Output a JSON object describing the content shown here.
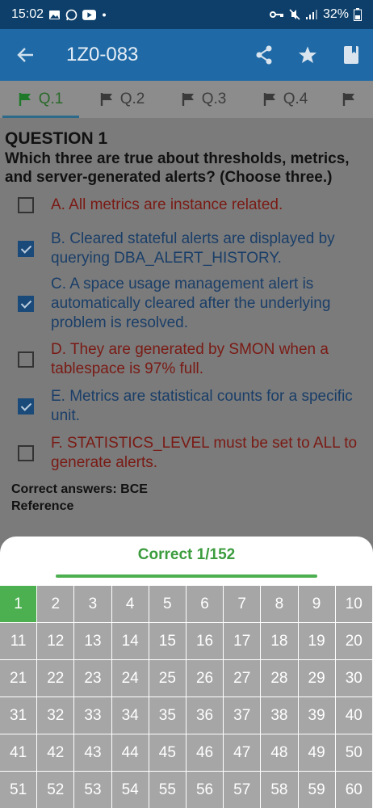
{
  "status_bar": {
    "time": "15:02",
    "left_icons": [
      "image-icon",
      "whatsapp-icon",
      "youtube-icon",
      "dot-icon"
    ],
    "right_icons": [
      "key-icon",
      "mute-icon",
      "signal-icon"
    ],
    "battery": "32%"
  },
  "app_bar": {
    "title": "1Z0-083",
    "actions": [
      "share-icon",
      "star-icon",
      "bookmark-icon"
    ]
  },
  "tabs": [
    {
      "label": "Q.1",
      "active": true
    },
    {
      "label": "Q.2"
    },
    {
      "label": "Q.3"
    },
    {
      "label": "Q.4"
    },
    {
      "label": ""
    }
  ],
  "question": {
    "title": "QUESTION 1",
    "text": "Which three are true about thresholds, metrics, and server-generated alerts? (Choose three.)",
    "options": [
      {
        "label": "A.  All metrics are instance related.",
        "checked": false,
        "correct": false
      },
      {
        "label": "B.  Cleared stateful alerts are displayed by querying DBA_ALERT_HISTORY.",
        "checked": true,
        "correct": true
      },
      {
        "label": "C.  A space usage management alert is automatically cleared after the underlying problem is resolved.",
        "checked": true,
        "correct": true
      },
      {
        "label": "D.  They are generated by SMON when a tablespace is 97% full.",
        "checked": false,
        "correct": false
      },
      {
        "label": "E.  Metrics are statistical counts for a specific unit.",
        "checked": true,
        "correct": true
      },
      {
        "label": "F.  STATISTICS_LEVEL must be set to ALL to generate alerts.",
        "checked": false,
        "correct": false
      }
    ],
    "correct_answers": "Correct answers: BCE",
    "reference": "Reference"
  },
  "sheet": {
    "title": "Correct 1/152",
    "current": 1,
    "numbers": [
      "1",
      "2",
      "3",
      "4",
      "5",
      "6",
      "7",
      "8",
      "9",
      "10",
      "11",
      "12",
      "13",
      "14",
      "15",
      "16",
      "17",
      "18",
      "19",
      "20",
      "21",
      "22",
      "23",
      "24",
      "25",
      "26",
      "27",
      "28",
      "29",
      "30",
      "31",
      "32",
      "33",
      "34",
      "35",
      "36",
      "37",
      "38",
      "39",
      "40",
      "41",
      "42",
      "43",
      "44",
      "45",
      "46",
      "47",
      "48",
      "49",
      "50",
      "51",
      "52",
      "53",
      "54",
      "55",
      "56",
      "57",
      "58",
      "59",
      "60"
    ]
  },
  "colors": {
    "status_bar": "#0d3f6a",
    "app_bar": "#1f6aa6",
    "accent_green": "#4caf50",
    "cell_grey": "#a6a6a6"
  }
}
